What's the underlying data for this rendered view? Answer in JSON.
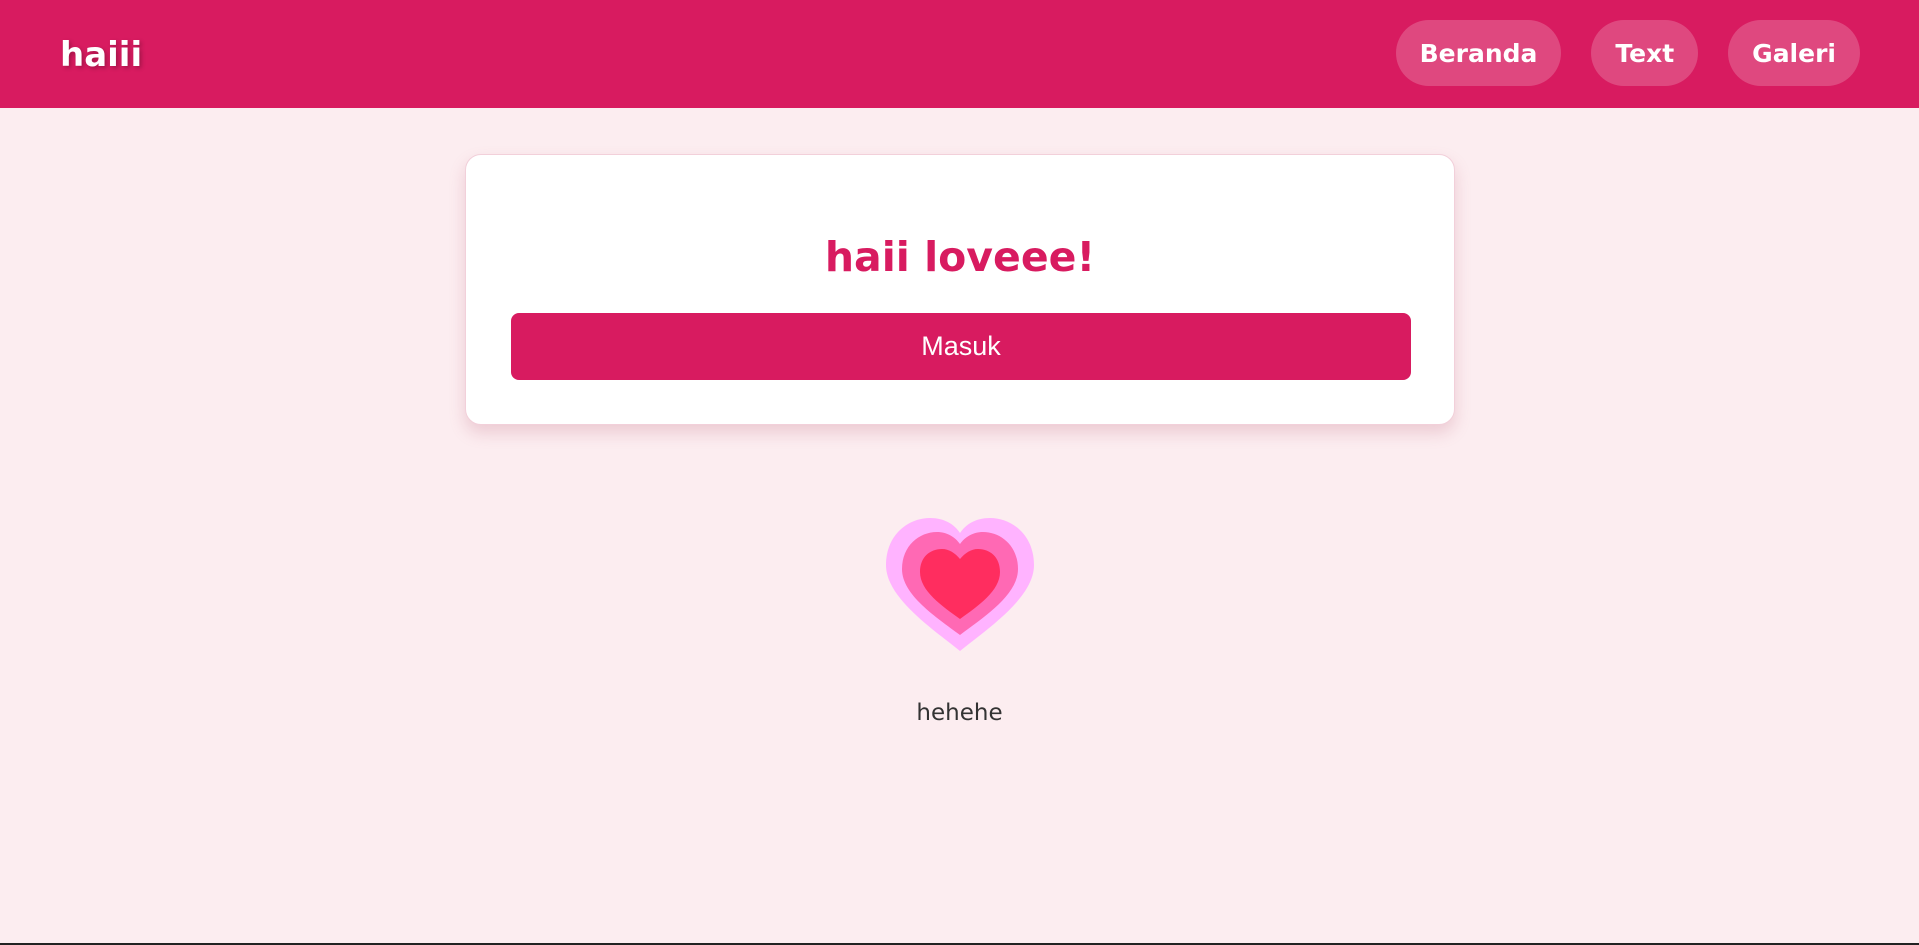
{
  "navbar": {
    "brand": "haiii",
    "links": [
      {
        "label": "Beranda"
      },
      {
        "label": "Text"
      },
      {
        "label": "Galeri"
      }
    ]
  },
  "card": {
    "title": "haii loveee!",
    "button_label": "Masuk"
  },
  "decoration": {
    "icon": "heart-icon",
    "colors": {
      "outer": "#ffb3ff",
      "middle": "#ff69b4",
      "inner": "#ff2d5f"
    }
  },
  "caption": "hehehe",
  "theme": {
    "accent": "#d81b60",
    "background": "#fcedf0"
  }
}
